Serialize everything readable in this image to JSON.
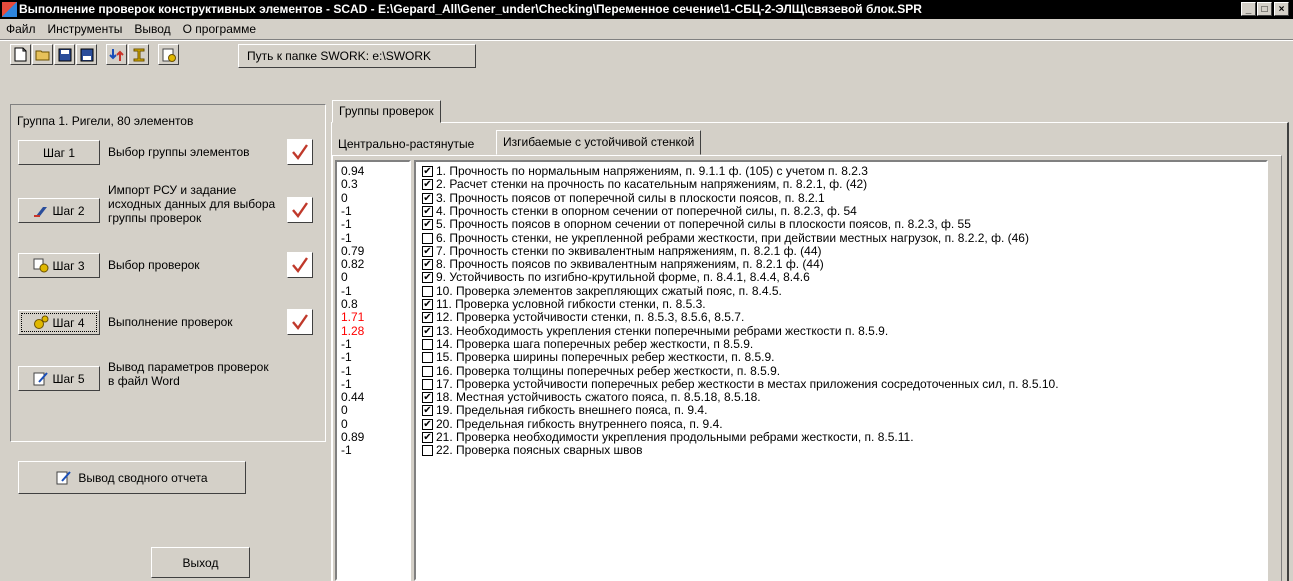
{
  "window": {
    "title": "Выполнение проверок конструктивных элементов - SCAD - E:\\Gepard_All\\Gener_under\\Checking\\Переменное сечение\\1-СБЦ-2-ЭЛЩ\\связевой блок.SPR",
    "minimize": "_",
    "maximize": "□",
    "close": "×"
  },
  "menu": [
    "Файл",
    "Инструменты",
    "Вывод",
    "О программе"
  ],
  "toolbar": {
    "buttons": [
      "new-file-icon",
      "open-folder-icon",
      "save-icon",
      "save-as-icon",
      "import-icon",
      "beam-icon",
      "settings-icon"
    ],
    "work_path": "Путь к папке SWORK: e:\\SWORK"
  },
  "group": {
    "title": "Группа 1. Ригели, 80 элементов"
  },
  "steps": [
    {
      "label": "Шаг 1",
      "text": "Выбор группы элементов",
      "icon": "",
      "checked": true
    },
    {
      "label": "Шаг 2",
      "text": "Импорт РСУ и задание исходных данных для выбора группы проверок",
      "icon": "import-icon",
      "checked": true
    },
    {
      "label": "Шаг 3",
      "text": "Выбор проверок",
      "icon": "select-icon",
      "checked": true
    },
    {
      "label": "Шаг 4",
      "text": "Выполнение проверок",
      "icon": "gears-icon",
      "checked": true
    },
    {
      "label": "Шаг 5",
      "text": "Вывод параметров проверок в файл Word",
      "icon": "word-export-icon",
      "checked": false
    }
  ],
  "buttons": {
    "summary_report": "Вывод сводного отчета",
    "exit": "Выход"
  },
  "tabs": {
    "outer": "Группы проверок",
    "inner": [
      "Центрально-растянутые",
      "Изгибаемые с устойчивой стенкой"
    ]
  },
  "colors": {
    "exceed": "#ff0000",
    "normal": "#000000",
    "checkmark": "#c0392b"
  },
  "checks": [
    {
      "value": "0.94",
      "checked": true,
      "exceed": false,
      "label": "1. Прочность по нормальным напряжениям, п. 9.1.1 ф. (105) с учетом п. 8.2.3"
    },
    {
      "value": "0.3",
      "checked": true,
      "exceed": false,
      "label": "2. Расчет стенки на прочность по касательным напряжениям, п. 8.2.1, ф. (42)"
    },
    {
      "value": "0",
      "checked": true,
      "exceed": false,
      "label": "3. Прочность поясов от поперечной силы в плоскости поясов, п. 8.2.1"
    },
    {
      "value": "-1",
      "checked": true,
      "exceed": false,
      "label": "4. Прочность стенки в опорном сечении от поперечной силы, п. 8.2.3, ф. 54"
    },
    {
      "value": "-1",
      "checked": true,
      "exceed": false,
      "label": "5. Прочность поясов в опорном сечении от поперечной силы в плоскости поясов, п. 8.2.3, ф. 55"
    },
    {
      "value": "-1",
      "checked": false,
      "exceed": false,
      "label": "6. Прочность стенки, не укрепленной ребрами жесткости, при действии местных нагрузок, п. 8.2.2, ф. (46)"
    },
    {
      "value": "0.79",
      "checked": true,
      "exceed": false,
      "label": "7. Прочность стенки по эквивалентным напряжениям, п. 8.2.1 ф. (44)"
    },
    {
      "value": "0.82",
      "checked": true,
      "exceed": false,
      "label": "8. Прочность поясов по эквивалентным напряжениям, п. 8.2.1 ф. (44)"
    },
    {
      "value": "0",
      "checked": true,
      "exceed": false,
      "label": "9. Устойчивость по изгибно-крутильной форме, п. 8.4.1, 8.4.4, 8.4.6"
    },
    {
      "value": "-1",
      "checked": false,
      "exceed": false,
      "label": "10. Проверка элементов закрепляющих сжатый пояс, п. 8.4.5."
    },
    {
      "value": "0.8",
      "checked": true,
      "exceed": false,
      "label": "11. Проверка условной гибкости стенки, п. 8.5.3."
    },
    {
      "value": "1.71",
      "checked": true,
      "exceed": true,
      "label": "12. Проверка устойчивости стенки, п. 8.5.3, 8.5.6, 8.5.7."
    },
    {
      "value": "1.28",
      "checked": true,
      "exceed": true,
      "label": "13. Необходимость укрепления стенки поперечными ребрами жесткости п. 8.5.9."
    },
    {
      "value": "-1",
      "checked": false,
      "exceed": false,
      "label": "14. Проверка шага поперечных ребер жесткости, п 8.5.9."
    },
    {
      "value": "-1",
      "checked": false,
      "exceed": false,
      "label": "15. Проверка ширины поперечных ребер жесткости, п. 8.5.9."
    },
    {
      "value": "-1",
      "checked": false,
      "exceed": false,
      "label": "16. Проверка толщины поперечных ребер жесткости, п. 8.5.9."
    },
    {
      "value": "-1",
      "checked": false,
      "exceed": false,
      "label": "17. Проверка устойчивости поперечных ребер жесткости в местах приложения сосредоточенных сил, п. 8.5.10."
    },
    {
      "value": "0.44",
      "checked": true,
      "exceed": false,
      "label": "18. Местная устойчивость сжатого пояса, п. 8.5.18, 8.5.18."
    },
    {
      "value": "0",
      "checked": true,
      "exceed": false,
      "label": "19. Предельная гибкость внешнего пояса, п. 9.4."
    },
    {
      "value": "0",
      "checked": true,
      "exceed": false,
      "label": "20. Предельная гибкость внутреннего пояса, п. 9.4."
    },
    {
      "value": "0.89",
      "checked": true,
      "exceed": false,
      "label": "21. Проверка необходимости укрепления продольными ребрами жесткости, п. 8.5.11."
    },
    {
      "value": "-1",
      "checked": false,
      "exceed": false,
      "label": "22. Проверка поясных сварных швов"
    }
  ]
}
